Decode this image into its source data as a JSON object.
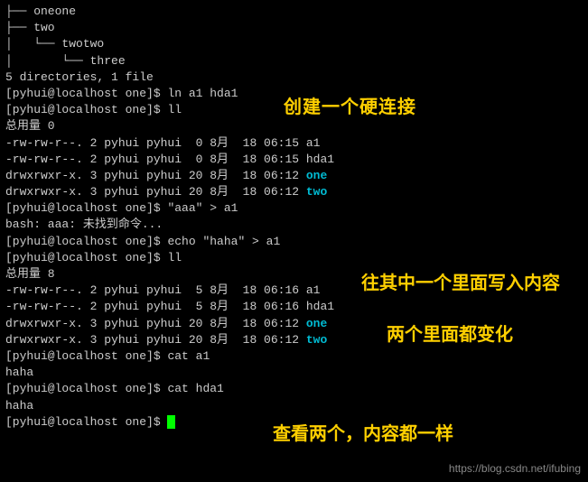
{
  "tree": {
    "line1": "├── oneone",
    "line2": "├── two",
    "line3": "│   └── twotwo",
    "line4": "│       └── three",
    "line5": ""
  },
  "summary": "5 directories, 1 file",
  "prompt": "[pyhui@localhost one]$ ",
  "cmd_ln": "ln a1 hda1",
  "cmd_ll1": "ll",
  "total0": "总用量 0",
  "ls1": {
    "a1": "-rw-rw-r--. 2 pyhui pyhui  0 8月  18 06:15 a1",
    "hda1": "-rw-rw-r--. 2 pyhui pyhui  0 8月  18 06:15 hda1",
    "one_pre": "drwxrwxr-x. 3 pyhui pyhui 20 8月  18 06:12 ",
    "one": "one",
    "two_pre": "drwxrwxr-x. 3 pyhui pyhui 20 8月  18 06:12 ",
    "two": "two"
  },
  "cmd_aaa": "\"aaa\" > a1",
  "bash_err": "bash: aaa: 未找到命令...",
  "cmd_echo": "echo \"haha\" > a1",
  "cmd_ll2": "ll",
  "total8": "总用量 8",
  "ls2": {
    "a1": "-rw-rw-r--. 2 pyhui pyhui  5 8月  18 06:16 a1",
    "hda1": "-rw-rw-r--. 2 pyhui pyhui  5 8月  18 06:16 hda1",
    "one_pre": "drwxrwxr-x. 3 pyhui pyhui 20 8月  18 06:12 ",
    "one": "one",
    "two_pre": "drwxrwxr-x. 3 pyhui pyhui 20 8月  18 06:12 ",
    "two": "two"
  },
  "cmd_cat_a1": "cat a1",
  "out_haha1": "haha",
  "cmd_cat_hda1": "cat hda1",
  "out_haha2": "haha",
  "annotations": {
    "a1": "创建一个硬连接",
    "a2": "往其中一个里面写入内容",
    "a3": "两个里面都变化",
    "a4": "查看两个，内容都一样"
  },
  "watermark": "https://blog.csdn.net/ifubing"
}
